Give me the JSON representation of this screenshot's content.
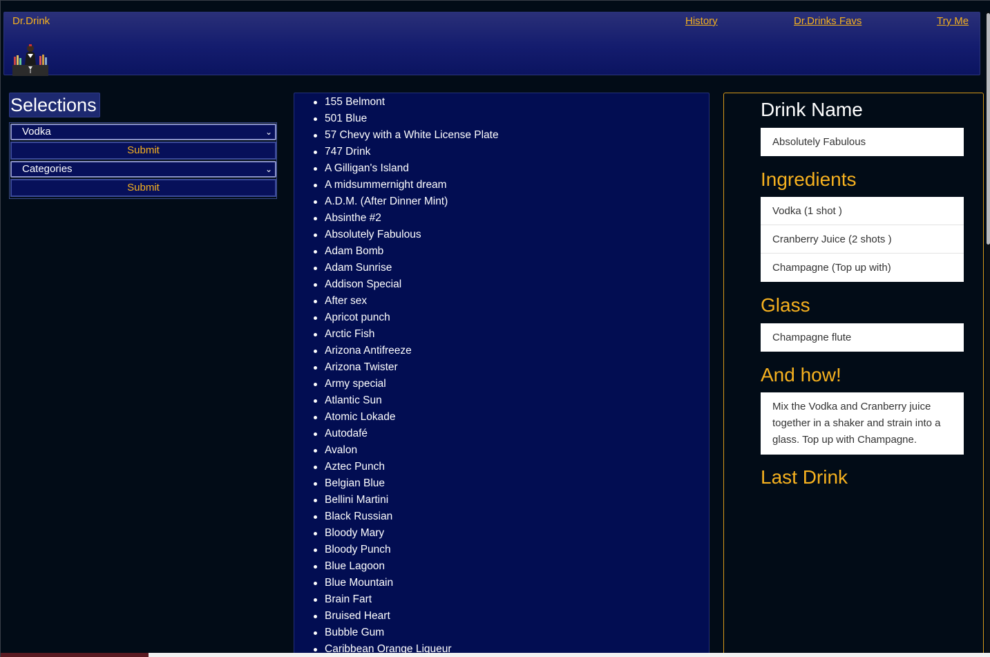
{
  "navbar": {
    "brand": "Dr.Drink",
    "links": [
      "History",
      "Dr.Drinks Favs",
      "Try Me"
    ]
  },
  "sidebar": {
    "title": "Selections",
    "spirit_select_value": "Vodka",
    "category_select_value": "Categories",
    "submit_label": "Submit"
  },
  "drink_list": [
    "155 Belmont",
    "501 Blue",
    "57 Chevy with a White License Plate",
    "747 Drink",
    "A Gilligan's Island",
    "A midsummernight dream",
    "A.D.M. (After Dinner Mint)",
    "Absinthe #2",
    "Absolutely Fabulous",
    "Adam Bomb",
    "Adam Sunrise",
    "Addison Special",
    "After sex",
    "Apricot punch",
    "Arctic Fish",
    "Arizona Antifreeze",
    "Arizona Twister",
    "Army special",
    "Atlantic Sun",
    "Atomic Lokade",
    "Autodafé",
    "Avalon",
    "Aztec Punch",
    "Belgian Blue",
    "Bellini Martini",
    "Black Russian",
    "Bloody Mary",
    "Bloody Punch",
    "Blue Lagoon",
    "Blue Mountain",
    "Brain Fart",
    "Bruised Heart",
    "Bubble Gum",
    "Caribbean Orange Liqueur"
  ],
  "detail": {
    "drink_name_heading": "Drink Name",
    "drink_name": "Absolutely Fabulous",
    "ingredients_heading": "Ingredients",
    "ingredients": [
      "Vodka (1 shot )",
      "Cranberry Juice (2 shots )",
      "Champagne (Top up with)"
    ],
    "glass_heading": "Glass",
    "glass": "Champagne flute",
    "how_heading": "And how!",
    "instructions": "Mix the Vodka and Cranberry juice together in a shaker and strain into a glass. Top up with Champagne.",
    "last_drink_heading": "Last Drink"
  },
  "colors": {
    "accent": "#f6b11f",
    "navy": "#020d52",
    "background": "#020c17"
  }
}
